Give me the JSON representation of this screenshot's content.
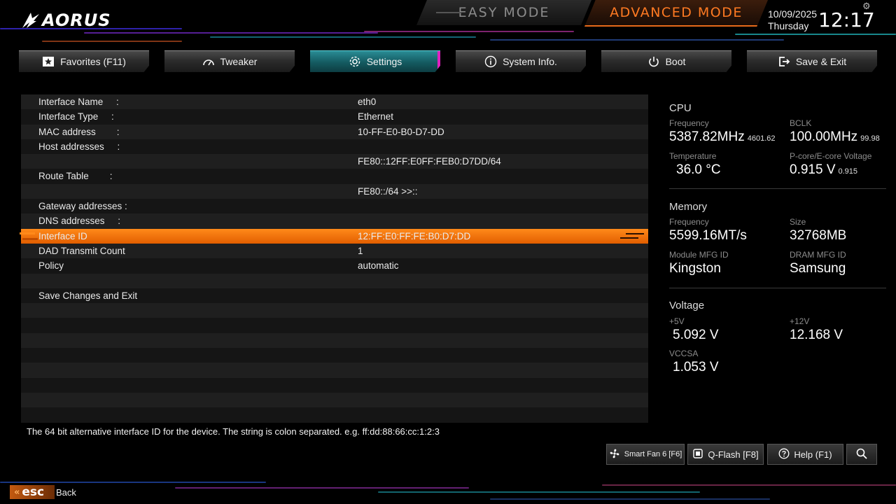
{
  "brand": {
    "logo_text": "AORUS"
  },
  "modes": {
    "easy_label": "EASY MODE",
    "advanced_label": "ADVANCED MODE"
  },
  "datetime": {
    "date": "10/09/2025",
    "day": "Thursday",
    "time": "12:17"
  },
  "tabs": [
    {
      "label": "Favorites (F11)",
      "icon": "star-icon"
    },
    {
      "label": "Tweaker",
      "icon": "gauge-icon"
    },
    {
      "label": "Settings",
      "icon": "gear-icon",
      "active": true
    },
    {
      "label": "System Info.",
      "icon": "info-icon"
    },
    {
      "label": "Boot",
      "icon": "power-icon"
    },
    {
      "label": "Save & Exit",
      "icon": "exit-icon"
    }
  ],
  "rows": [
    {
      "label": "Interface Name     :",
      "value": "eth0"
    },
    {
      "label": "Interface Type     :",
      "value": "Ethernet"
    },
    {
      "label": "MAC address        :",
      "value": "10-FF-E0-B0-D7-DD"
    },
    {
      "label": "Host addresses     :",
      "value": ""
    },
    {
      "label": "",
      "value": "FE80::12FF:E0FF:FEB0:D7DD/64"
    },
    {
      "label": "Route Table        :",
      "value": ""
    },
    {
      "label": "",
      "value": "FE80::/64 >>::"
    },
    {
      "label": "Gateway addresses :",
      "value": ""
    },
    {
      "label": "DNS addresses     :",
      "value": ""
    },
    {
      "label": "Interface ID",
      "value": "12:FF:E0:FF:FE:B0:D7:DD",
      "selected": true
    },
    {
      "label": "DAD Transmit Count",
      "value": "1"
    },
    {
      "label": "Policy",
      "value": "automatic"
    },
    {
      "label": "",
      "value": ""
    },
    {
      "label": "Save Changes and Exit",
      "value": ""
    }
  ],
  "help_text": "The 64 bit alternative interface ID for the device. The string is colon separated. e.g. ff:dd:88:66:cc:1:2:3",
  "cpu": {
    "title": "CPU",
    "freq_label": "Frequency",
    "freq_value": "5387.82MHz",
    "freq_sub": "4601.62",
    "bclk_label": "BCLK",
    "bclk_value": "100.00MHz",
    "bclk_sub": "99.98",
    "temp_label": "Temperature",
    "temp_value": "36.0 °C",
    "volt_label": "P-core/E-core Voltage",
    "volt_value": "0.915 V",
    "volt_sub": "0.915"
  },
  "memory": {
    "title": "Memory",
    "freq_label": "Frequency",
    "freq_value": "5599.16MT/s",
    "size_label": "Size",
    "size_value": "32768MB",
    "module_label": "Module MFG ID",
    "module_value": "Kingston",
    "dram_label": "DRAM MFG ID",
    "dram_value": "Samsung"
  },
  "voltage": {
    "title": "Voltage",
    "v5_label": "+5V",
    "v5_value": "5.092 V",
    "v12_label": "+12V",
    "v12_value": "12.168 V",
    "vccsa_label": "VCCSA",
    "vccsa_value": "1.053 V"
  },
  "bottom": {
    "smartfan_label": "Smart Fan 6 [F6]",
    "qflash_label": "Q-Flash [F8]",
    "help_label": "Help (F1)",
    "esc_label": "esc",
    "back_label": "Back"
  },
  "colors": {
    "accent_orange": "#ff7a22",
    "accent_teal": "#2a8c95",
    "accent_magenta": "#e020c0"
  }
}
